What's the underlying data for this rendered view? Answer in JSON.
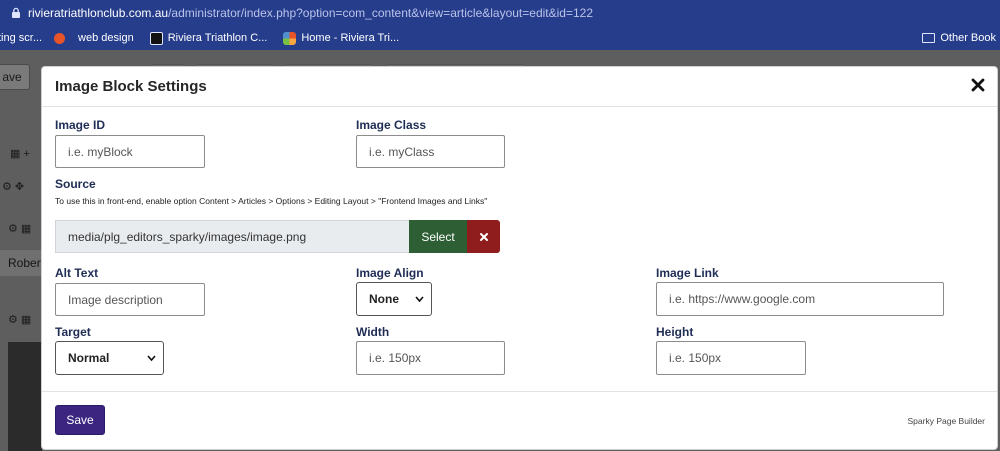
{
  "browser": {
    "url_host": "rivieratriathlonclub.com.au",
    "url_path": "/administrator/index.php?option=com_content&view=article&layout=edit&id=122",
    "bookmarks": [
      {
        "label": "ting scr..."
      },
      {
        "label": "web design"
      },
      {
        "label": "Riviera Triathlon C..."
      },
      {
        "label": "Home - Riviera Tri..."
      }
    ],
    "other_bookmarks": "Other Book"
  },
  "background": {
    "save_label": "ave",
    "author_name": "Robert"
  },
  "modal": {
    "title": "Image Block Settings",
    "image_id": {
      "label": "Image ID",
      "placeholder": "i.e. myBlock"
    },
    "image_class": {
      "label": "Image Class",
      "placeholder": "i.e. myClass"
    },
    "source": {
      "label": "Source",
      "hint": "To use this in front-end, enable option Content > Articles > Options > Editing Layout > \"Frontend Images and Links\"",
      "value": "media/plg_editors_sparky/images/image.png",
      "select_label": "Select"
    },
    "alt_text": {
      "label": "Alt Text",
      "placeholder": "Image description"
    },
    "image_align": {
      "label": "Image Align",
      "value": "None"
    },
    "image_link": {
      "label": "Image Link",
      "placeholder": "i.e. https://www.google.com"
    },
    "target": {
      "label": "Target",
      "value": "Normal"
    },
    "width": {
      "label": "Width",
      "placeholder": "i.e. 150px"
    },
    "height": {
      "label": "Height",
      "placeholder": "i.e. 150px"
    },
    "footer": {
      "save_label": "Save",
      "brand": "Sparky Page Builder"
    }
  },
  "colors": {
    "browser_bar": "#263d8c",
    "select_button": "#2e5e33",
    "clear_button": "#8f1d1d",
    "save_button": "#3b2580"
  }
}
